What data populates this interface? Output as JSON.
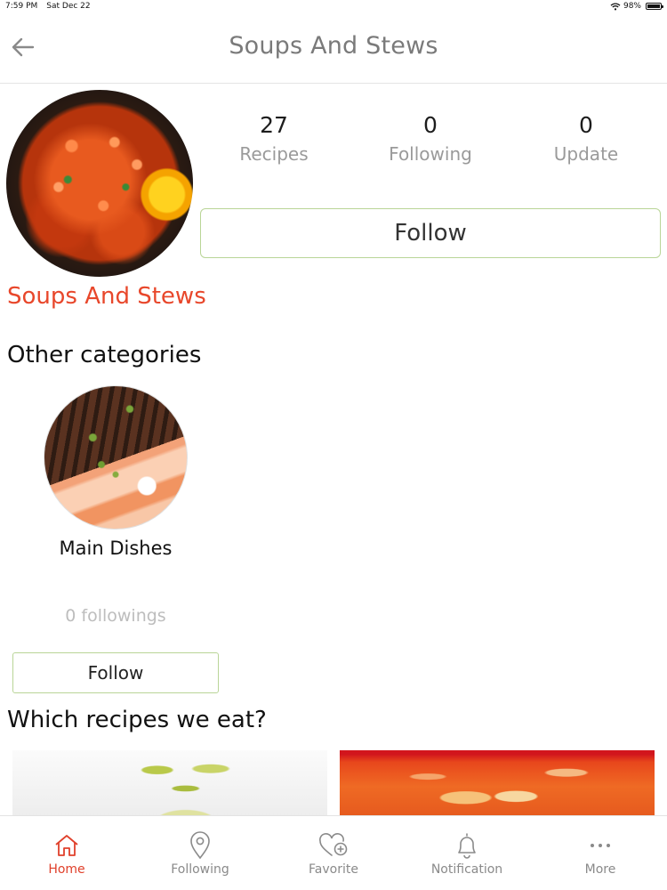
{
  "status_bar": {
    "time": "7:59 PM",
    "date": "Sat Dec 22",
    "battery": "98%"
  },
  "nav": {
    "title": "Soups And Stews",
    "back_icon": "back-arrow-icon"
  },
  "profile": {
    "stats": [
      {
        "value": "27",
        "label": "Recipes"
      },
      {
        "value": "0",
        "label": "Following"
      },
      {
        "value": "0",
        "label": "Update"
      }
    ],
    "follow_label": "Follow",
    "category_title": "Soups And Stews"
  },
  "other_categories": {
    "heading": "Other categories",
    "items": [
      {
        "name": "Main Dishes",
        "followings": "0 followings",
        "follow_label": "Follow"
      }
    ]
  },
  "recipes_section": {
    "heading": "Which recipes we eat?"
  },
  "tab_bar": {
    "items": [
      {
        "label": "Home",
        "icon": "home-icon",
        "active": true
      },
      {
        "label": "Following",
        "icon": "location-pin-icon",
        "active": false
      },
      {
        "label": "Favorite",
        "icon": "heart-plus-icon",
        "active": false
      },
      {
        "label": "Notification",
        "icon": "bell-icon",
        "active": false
      },
      {
        "label": "More",
        "icon": "more-dots-icon",
        "active": false
      }
    ]
  },
  "colors": {
    "accent": "#e8472b",
    "follow_border": "#b9d597",
    "muted_text": "#9a9a9a"
  }
}
